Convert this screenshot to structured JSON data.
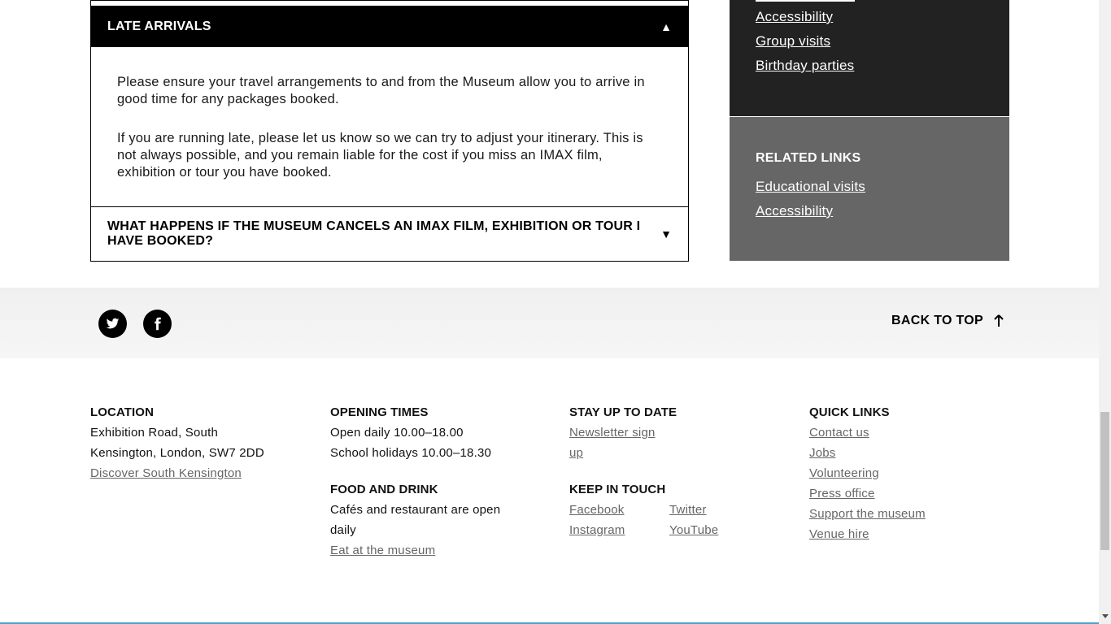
{
  "accordion": {
    "open_item": {
      "title": "LATE ARRIVALS",
      "arrow": "▲",
      "paragraphs": [
        "Please ensure your travel arrangements to and from the Museum allow you to arrive in good time for any packages booked.",
        "If you are running late, please let us know so we can try to adjust your itinerary. This is not always possible, and you remain liable for the cost if you miss an IMAX film, exhibition or tour you have booked."
      ]
    },
    "closed_item": {
      "title": "WHAT HAPPENS IF THE MUSEUM CANCELS AN IMAX FILM, EXHIBITION OR TOUR I HAVE BOOKED?",
      "arrow": "▼"
    }
  },
  "sidebar": {
    "dark_links": [
      "Accessibility",
      "Group visits",
      "Birthday parties"
    ],
    "related": {
      "heading": "RELATED LINKS",
      "links": [
        "Educational visits",
        "Accessibility"
      ]
    }
  },
  "social_bar": {
    "twitter_icon": "twitter-icon",
    "facebook_icon": "facebook-icon",
    "back_to_top": "BACK TO TOP"
  },
  "footer": {
    "location": {
      "heading": "LOCATION",
      "address_line1": "Exhibition Road, South",
      "address_line2": "Kensington, London, SW7 2DD",
      "link": "Discover South Kensington"
    },
    "opening": {
      "heading": "OPENING TIMES",
      "line1": "Open daily 10.00–18.00",
      "line2": "School holidays 10.00–18.30"
    },
    "food": {
      "heading": "FOOD AND DRINK",
      "line1": "Cafés and restaurant are open",
      "line2": "daily",
      "link": "Eat at the museum"
    },
    "stay": {
      "heading": "STAY UP TO DATE",
      "link": "Newsletter sign up"
    },
    "keep": {
      "heading": "KEEP IN TOUCH",
      "links": [
        "Facebook",
        "Twitter",
        "Instagram",
        "YouTube"
      ]
    },
    "quick": {
      "heading": "QUICK LINKS",
      "links": [
        "Contact us",
        "Jobs",
        "Volunteering",
        "Press office",
        "Support the museum",
        "Venue hire"
      ]
    }
  },
  "colors": {
    "accordion_header": "#000000",
    "sidebar_dark": "#222222",
    "sidebar_gray": "#666666",
    "footer_link": "#666666"
  }
}
